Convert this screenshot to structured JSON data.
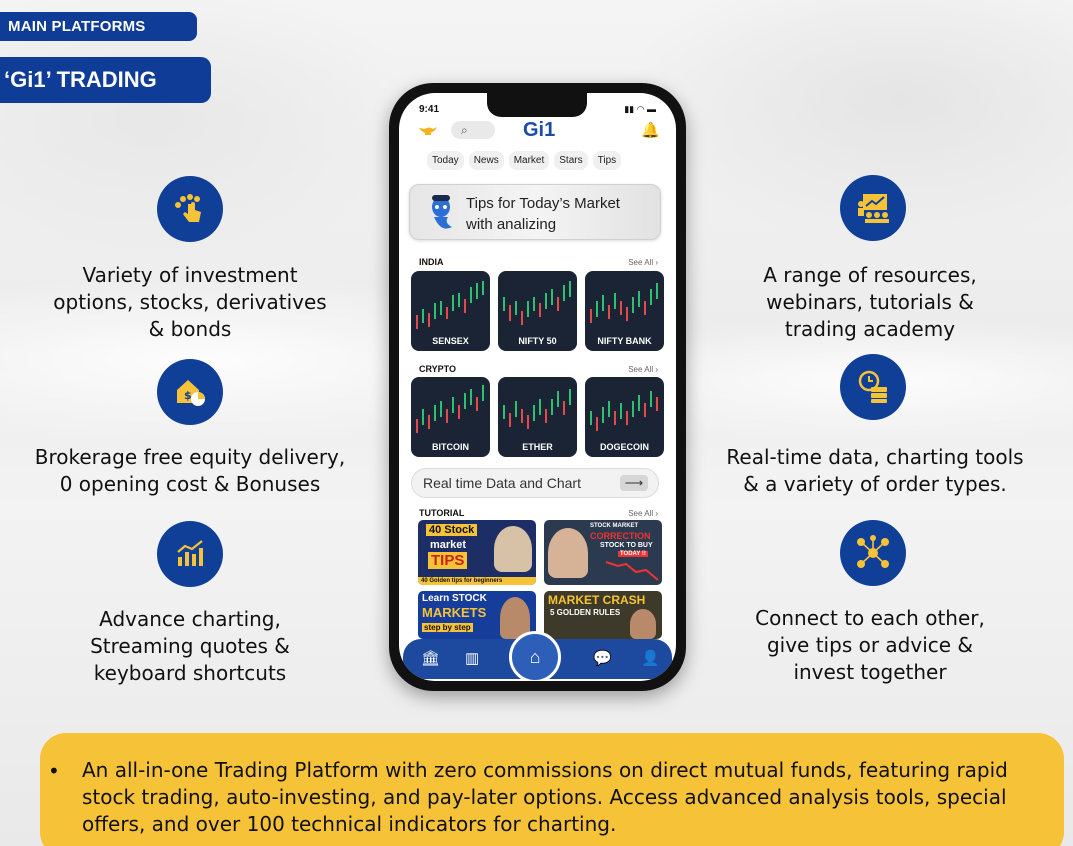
{
  "tags": {
    "main_platforms": "MAIN PLATFORMS",
    "gi1_trading": "‘Gi1’ TRADING"
  },
  "colors": {
    "brand_blue": "#103f98",
    "accent_yellow": "#f6c238"
  },
  "features_left": [
    {
      "icon": "hand-tap-icon",
      "text": "Variety of investment\noptions, stocks, derivatives\n& bonds"
    },
    {
      "icon": "house-chart-icon",
      "text": "Brokerage free equity delivery,\n0 opening cost & Bonuses"
    },
    {
      "icon": "bar-chart-icon",
      "text": "Advance charting,\nStreaming quotes &\nkeyboard shortcuts"
    }
  ],
  "features_right": [
    {
      "icon": "presentation-icon",
      "text": "A range of resources,\nwebinars, tutorials &\ntrading academy"
    },
    {
      "icon": "realtime-data-icon",
      "text": "Real-time data, charting tools\n& a variety of order types."
    },
    {
      "icon": "network-people-icon",
      "text": "Connect to each other,\ngive tips or advice &\ninvest together"
    }
  ],
  "phone": {
    "time": "9:41",
    "app_name": "Gi1",
    "tabs": [
      "Today",
      "News",
      "Market",
      "Stars",
      "Tips"
    ],
    "banner_text": "Tips for Today’s Market\nwith analizing",
    "see_all": "See All ›",
    "india": {
      "title": "INDIA",
      "cards": [
        "SENSEX",
        "NIFTY 50",
        "NIFTY BANK"
      ]
    },
    "crypto": {
      "title": "CRYPTO",
      "cards": [
        "BITCOIN",
        "ETHER",
        "DOGECOIN"
      ]
    },
    "realtime_button": "Real time Data and Chart",
    "tutorial": {
      "title": "TUTORIAL",
      "thumb1": {
        "line1": "40 Stock",
        "line2": "market",
        "line3": "TIPS",
        "footer": "40 Golden tips for beginners"
      },
      "thumb2": {
        "line1": "STOCK MARKET",
        "line2": "CORRECTION",
        "line3": "STOCK TO BUY",
        "line4": "TODAY !!"
      },
      "thumb3": {
        "line1": "Learn STOCK",
        "line2": "MARKETS",
        "line3": "step by step"
      },
      "thumb4": {
        "line1": "MARKET CRASH",
        "line2": "5 GOLDEN RULES"
      }
    }
  },
  "bottom_note": "An all-in-one Trading Platform with zero commissions on direct mutual funds, featuring rapid stock trading, auto-investing, and pay-later options. Access advanced analysis tools, special offers, and over 100 technical indicators for charting."
}
